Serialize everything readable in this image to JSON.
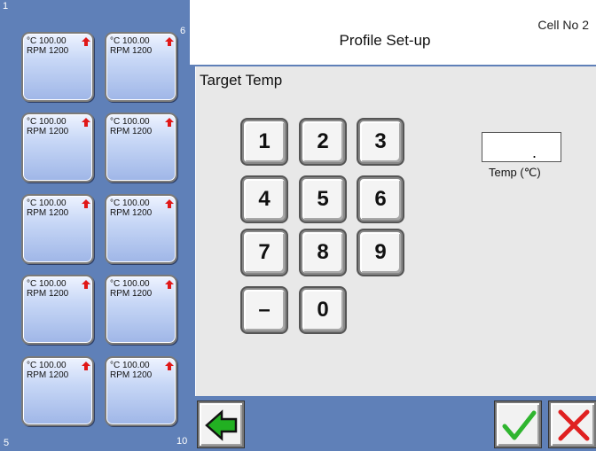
{
  "header": {
    "title": "Profile Set-up",
    "cell_no": "Cell No 2"
  },
  "sidebar": {
    "corner_labels": {
      "top_left": "1",
      "top_right": "6",
      "bottom_left": "5",
      "bottom_right": "10"
    },
    "cells": [
      {
        "temp": "°C 100.00",
        "rpm": "RPM 1200",
        "indicator": "up-arrow-icon"
      },
      {
        "temp": "°C 100.00",
        "rpm": "RPM 1200",
        "indicator": "up-arrow-icon"
      },
      {
        "temp": "°C 100.00",
        "rpm": "RPM 1200",
        "indicator": "up-arrow-icon"
      },
      {
        "temp": "°C 100.00",
        "rpm": "RPM 1200",
        "indicator": "up-arrow-icon"
      },
      {
        "temp": "°C 100.00",
        "rpm": "RPM 1200",
        "indicator": "up-arrow-icon"
      },
      {
        "temp": "°C 100.00",
        "rpm": "RPM 1200",
        "indicator": "up-arrow-icon"
      },
      {
        "temp": "°C 100.00",
        "rpm": "RPM 1200",
        "indicator": "up-arrow-icon"
      },
      {
        "temp": "°C 100.00",
        "rpm": "RPM 1200",
        "indicator": "up-arrow-icon"
      },
      {
        "temp": "°C 100.00",
        "rpm": "RPM 1200",
        "indicator": "up-arrow-icon"
      },
      {
        "temp": "°C 100.00",
        "rpm": "RPM 1200",
        "indicator": "up-arrow-icon"
      }
    ]
  },
  "main": {
    "section_label": "Target Temp",
    "keypad": {
      "keys": [
        "1",
        "2",
        "3",
        "4",
        "5",
        "6",
        "7",
        "8",
        "9",
        "–",
        "0"
      ]
    },
    "temp_field": {
      "value": ".",
      "label": "Temp (℃)"
    }
  },
  "footer": {
    "back_icon": "left-arrow-icon",
    "confirm_icon": "check-icon",
    "cancel_icon": "cross-icon"
  },
  "colors": {
    "frame_blue": "#5f80b8",
    "panel_gray": "#e8e8e8",
    "arrow_red": "#e01818",
    "check_green": "#2fb52f",
    "cross_red": "#e02020",
    "back_green": "#22b022"
  }
}
